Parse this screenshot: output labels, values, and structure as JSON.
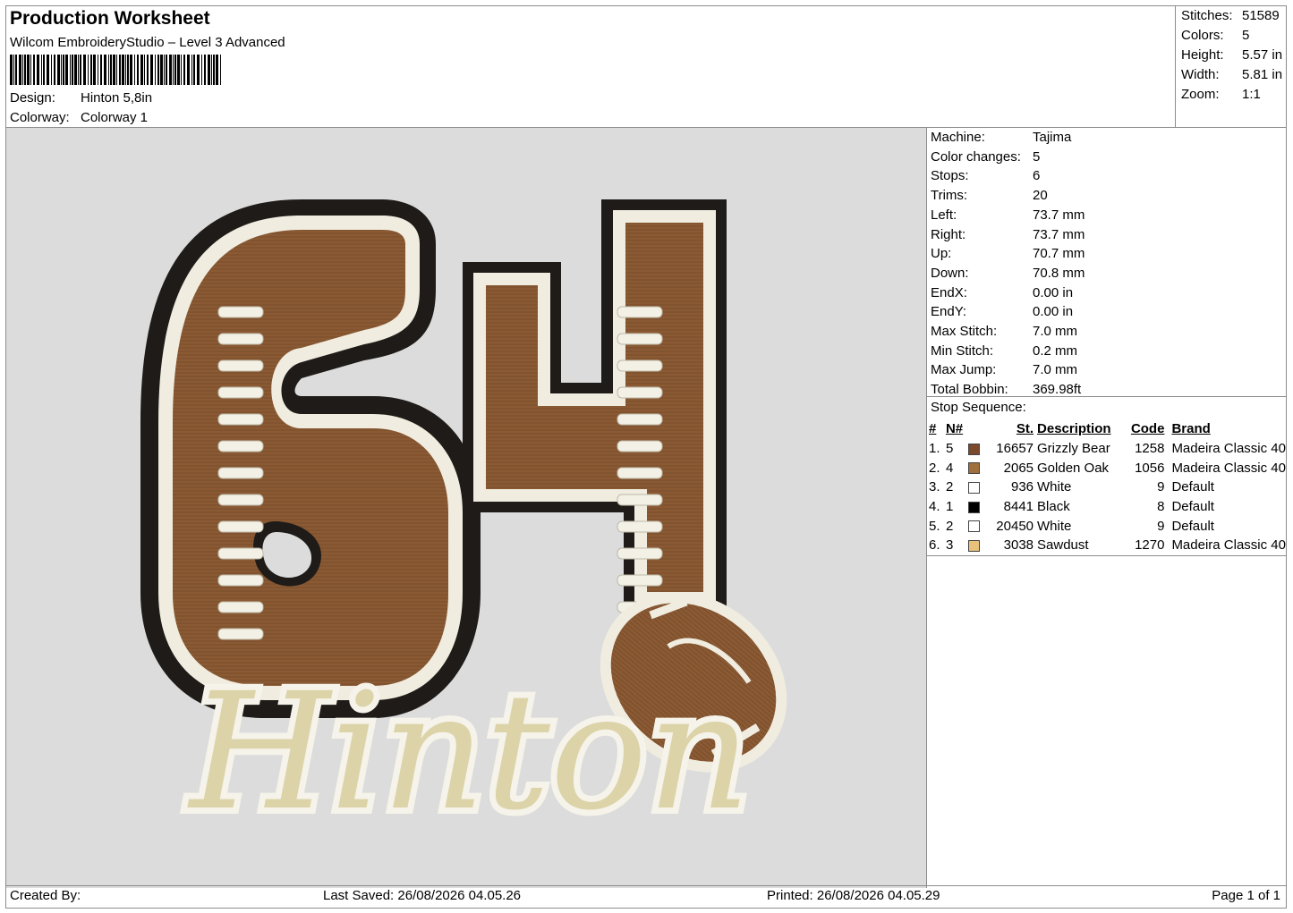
{
  "header": {
    "title": "Production Worksheet",
    "software": "Wilcom EmbroideryStudio – Level 3 Advanced",
    "design_label": "Design:",
    "design_value": "Hinton 5,8in",
    "colorway_label": "Colorway:",
    "colorway_value": "Colorway 1"
  },
  "stats": [
    {
      "label": "Stitches:",
      "value": "51589"
    },
    {
      "label": "Colors:",
      "value": "5"
    },
    {
      "label": "Height:",
      "value": "5.57 in"
    },
    {
      "label": "Width:",
      "value": "5.81 in"
    },
    {
      "label": "Zoom:",
      "value": "1:1"
    }
  ],
  "machine_info": [
    {
      "label": "Machine:",
      "value": "Tajima"
    },
    {
      "label": "Color changes:",
      "value": "5"
    },
    {
      "label": "Stops:",
      "value": "6"
    },
    {
      "label": "Trims:",
      "value": "20"
    },
    {
      "label": "Left:",
      "value": "73.7 mm"
    },
    {
      "label": "Right:",
      "value": "73.7 mm"
    },
    {
      "label": "Up:",
      "value": "70.7 mm"
    },
    {
      "label": "Down:",
      "value": "70.8 mm"
    },
    {
      "label": "EndX:",
      "value": "0.00 in"
    },
    {
      "label": "EndY:",
      "value": "0.00 in"
    },
    {
      "label": "Max Stitch:",
      "value": "7.0 mm"
    },
    {
      "label": "Min Stitch:",
      "value": "0.2 mm"
    },
    {
      "label": "Max Jump:",
      "value": "7.0 mm"
    },
    {
      "label": "Total Bobbin:",
      "value": "369.98ft"
    }
  ],
  "stop_sequence": {
    "title": "Stop Sequence:",
    "columns": [
      "#",
      "N#",
      "St.",
      "Description",
      "Code",
      "Brand"
    ],
    "rows": [
      {
        "num": "1.",
        "n": "5",
        "color": "#7a4a2a",
        "st": "16657",
        "desc": "Grizzly Bear",
        "code": "1258",
        "brand": "Madeira Classic 40"
      },
      {
        "num": "2.",
        "n": "4",
        "color": "#a0703c",
        "st": "2065",
        "desc": "Golden Oak",
        "code": "1056",
        "brand": "Madeira Classic 40"
      },
      {
        "num": "3.",
        "n": "2",
        "color": "#ffffff",
        "st": "936",
        "desc": "White",
        "code": "9",
        "brand": "Default"
      },
      {
        "num": "4.",
        "n": "1",
        "color": "#000000",
        "st": "8441",
        "desc": "Black",
        "code": "8",
        "brand": "Default"
      },
      {
        "num": "5.",
        "n": "2",
        "color": "#ffffff",
        "st": "20450",
        "desc": "White",
        "code": "9",
        "brand": "Default"
      },
      {
        "num": "6.",
        "n": "3",
        "color": "#e8c27a",
        "st": "3038",
        "desc": "Sawdust",
        "code": "1270",
        "brand": "Madeira Classic 40"
      }
    ]
  },
  "design_text": {
    "number": "64",
    "name": "Hinton"
  },
  "footer": {
    "created_by": "Created By:",
    "last_saved": "Last Saved: 26/08/2026 04.05.26",
    "printed": "Printed: 26/08/2026 04.05.29",
    "page": "Page 1 of 1"
  }
}
